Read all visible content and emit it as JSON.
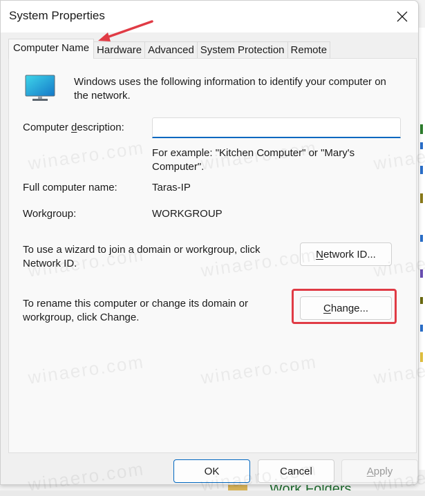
{
  "window": {
    "title": "System Properties",
    "close_icon": "close-icon"
  },
  "tabs": [
    {
      "label": "Computer Name",
      "active": true
    },
    {
      "label": "Hardware",
      "active": false
    },
    {
      "label": "Advanced",
      "active": false
    },
    {
      "label": "System Protection",
      "active": false
    },
    {
      "label": "Remote",
      "active": false
    }
  ],
  "computer_name_tab": {
    "icon": "monitor-icon",
    "intro": "Windows uses the following information to identify your computer on the network.",
    "description_label_pre": "Computer ",
    "description_label_accel": "d",
    "description_label_post": "escription:",
    "description_value": "",
    "description_placeholder": "",
    "example_text": "For example: \"Kitchen Computer\" or \"Mary's Computer\".",
    "full_name_label": "Full computer name:",
    "full_name_value": "Taras-IP",
    "workgroup_label": "Workgroup:",
    "workgroup_value": "WORKGROUP",
    "wizard_text": "To use a wizard to join a domain or workgroup, click Network ID.",
    "network_id_button": {
      "accel": "N",
      "rest": "etwork ID..."
    },
    "rename_text": "To rename this computer or change its domain or workgroup, click Change.",
    "change_button": {
      "accel": "C",
      "rest": "hange..."
    }
  },
  "footer": {
    "ok": "OK",
    "cancel": "Cancel",
    "apply_accel": "A",
    "apply_rest": "pply",
    "apply_enabled": false
  },
  "annotations": {
    "arrow_color": "#e03b45",
    "highlight_color": "#e03b45"
  },
  "watermark": "winaero.com",
  "background_window": {
    "partial_text": "Work Folders"
  },
  "colors": {
    "accent": "#0067c0",
    "annotation_red": "#e03b45"
  }
}
